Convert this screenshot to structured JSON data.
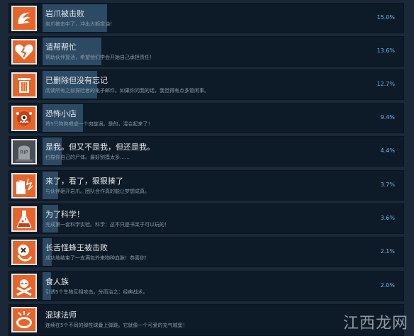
{
  "achievements": [
    {
      "title": "岩爪被击败",
      "desc": "岩爪被击中了，冲出大额赏油！",
      "pct": "15.0%",
      "fill": 15.0,
      "icon": "claw-icon"
    },
    {
      "title": "请帮帮忙",
      "desc": "帮助伙伴复活，希望他们学会开始自己承担责任！",
      "pct": "13.6%",
      "fill": 13.6,
      "icon": "broken-heart-icon"
    },
    {
      "title": "已删除但没有忘记",
      "desc": "阅读所有之前探险者的电子邮件。如果你问我的话，我觉得有点多管闲事。",
      "pct": "12.7%",
      "fill": 12.7,
      "icon": "trash-can-icon"
    },
    {
      "title": "恐怖小店",
      "desc": "将5只狗狗喂成一个肉旋涡。是的，混合起来了！",
      "pct": "9.4%",
      "fill": 9.4,
      "icon": "monster-face-icon"
    },
    {
      "title": "是我。但又不是我，但还是我。",
      "desc": "扫描你自己的尸体。最好别摸太多……",
      "pct": "4.4%",
      "fill": 4.4,
      "icon": "tombstone-icon"
    },
    {
      "title": "来了，看了，狠狠揍了",
      "desc": "与伙伴砸开岩爪。团队合作真的能让梦想成真。",
      "pct": "3.7%",
      "fill": 3.7,
      "icon": "punch-hand-icon"
    },
    {
      "title": "为了科学！",
      "desc": "完成第一套科学实验。科学：这不只是书呆子可以玩的！",
      "pct": "3.6%",
      "fill": 3.6,
      "icon": "flask-icon"
    },
    {
      "title": "长舌怪蜂王被击败",
      "desc": "成功地结束了一支满包外来物种血脉！恭喜你！",
      "pct": "2.1%",
      "fill": 2.1,
      "icon": "creature-eye-icon"
    },
    {
      "title": "食人族",
      "desc": "引诱5个生物互相攻击。分而治之：经典战术。",
      "pct": "2.0%",
      "fill": 2.0,
      "icon": "crossbones-icon"
    },
    {
      "title": "混球法师",
      "desc": "连续在5个不同的弹性球叠上弹跳。它就像一个可爱的充气城堡！",
      "pct": "",
      "fill": 0,
      "icon": "jelly-ball-icon"
    }
  ],
  "watermark": "江西龙网"
}
